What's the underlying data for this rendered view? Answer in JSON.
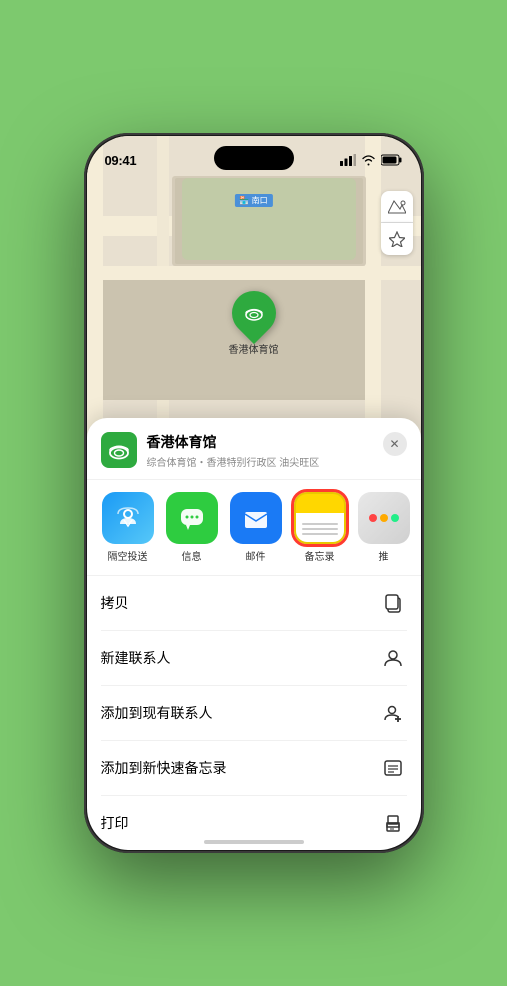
{
  "status_bar": {
    "time": "09:41",
    "signal": "●●●",
    "wifi": "wifi",
    "battery": "battery"
  },
  "map": {
    "label_text": "南口",
    "controls": {
      "map_icon": "🗺",
      "location_icon": "➤"
    }
  },
  "location_pin": {
    "label": "香港体育馆",
    "emoji": "🏟"
  },
  "place_card": {
    "name": "香港体育馆",
    "subtitle": "综合体育馆・香港特别行政区 油尖旺区",
    "close": "✕"
  },
  "share_items": [
    {
      "id": "airdrop",
      "label": "隔空投送"
    },
    {
      "id": "messages",
      "label": "信息"
    },
    {
      "id": "mail",
      "label": "邮件"
    },
    {
      "id": "notes",
      "label": "备忘录",
      "selected": true
    }
  ],
  "more_share": {
    "label": "推"
  },
  "action_rows": [
    {
      "id": "copy",
      "label": "拷贝",
      "icon": "copy"
    },
    {
      "id": "new-contact",
      "label": "新建联系人",
      "icon": "person"
    },
    {
      "id": "add-existing",
      "label": "添加到现有联系人",
      "icon": "person-add"
    },
    {
      "id": "add-notes",
      "label": "添加到新快速备忘录",
      "icon": "note"
    },
    {
      "id": "print",
      "label": "打印",
      "icon": "print"
    }
  ],
  "colors": {
    "green": "#2eaa3f",
    "airdrop_start": "#1a9af5",
    "airdrop_end": "#56c8f8",
    "messages": "#2ecc40",
    "mail": "#1a7af5",
    "selected_border": "#ff3b30"
  }
}
